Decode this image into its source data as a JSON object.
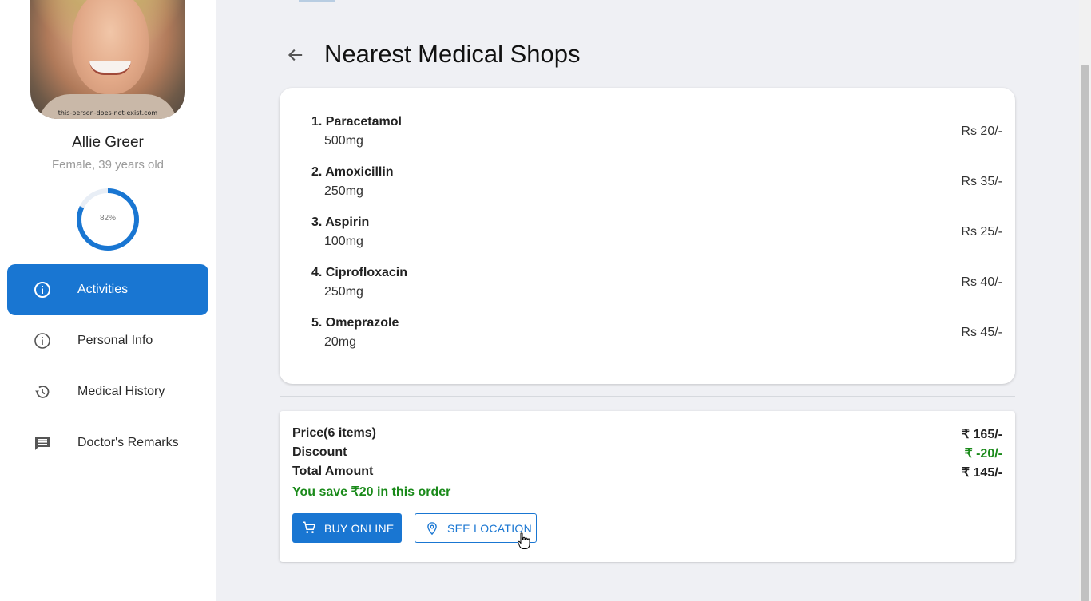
{
  "user": {
    "name": "Allie Greer",
    "subtitle": "Female, 39 years old",
    "avatar_watermark": "this-person-does-not-exist.com",
    "progress_percent": 82,
    "progress_label": "82%"
  },
  "sidebar": {
    "items": [
      {
        "label": "Activities",
        "icon": "info-icon",
        "active": true
      },
      {
        "label": "Personal Info",
        "icon": "info-icon",
        "active": false
      },
      {
        "label": "Medical History",
        "icon": "history-icon",
        "active": false
      },
      {
        "label": "Doctor's Remarks",
        "icon": "comment-icon",
        "active": false
      }
    ]
  },
  "page": {
    "title": "Nearest Medical Shops",
    "back_icon": "arrow-left-icon"
  },
  "medicines": [
    {
      "name": "1. Paracetamol",
      "dose": "500mg",
      "price": "Rs 20/-"
    },
    {
      "name": "2. Amoxicillin",
      "dose": "250mg",
      "price": "Rs 35/-"
    },
    {
      "name": "3. Aspirin",
      "dose": "100mg",
      "price": "Rs 25/-"
    },
    {
      "name": "4. Ciprofloxacin",
      "dose": "250mg",
      "price": "Rs 40/-"
    },
    {
      "name": "5. Omeprazole",
      "dose": "20mg",
      "price": "Rs 45/-"
    }
  ],
  "summary": {
    "price_label": "Price(6 items)",
    "price_value": "₹ 165/-",
    "discount_label": "Discount",
    "discount_value": "₹ -20/-",
    "total_label": "Total Amount",
    "total_value": "₹ 145/-",
    "savings_text": "You save ₹20 in this order"
  },
  "actions": {
    "buy_label": "BUY ONLINE",
    "buy_icon": "cart-icon",
    "location_label": "SEE LOCATION",
    "location_icon": "location-pin-icon"
  },
  "colors": {
    "primary": "#1976d2",
    "success": "#1a8a1a",
    "background": "#eff0f4"
  }
}
